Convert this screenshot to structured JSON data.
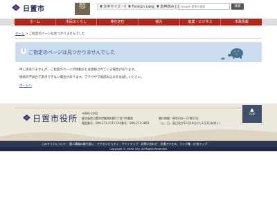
{
  "header": {
    "logo_text": "日置市",
    "helper": {
      "line1": "総合",
      "line2": "TOP"
    },
    "links": [
      {
        "label": "▼ 文字サイズ・色合い"
      },
      {
        "label": "▼ Foreign Language"
      },
      {
        "label": "▼ 音声読み上げ"
      }
    ],
    "search_placeholder": "Google 提供の検索",
    "search_button": "検索"
  },
  "nav": {
    "items": [
      {
        "label": "ホーム"
      },
      {
        "label": "市民のくらし"
      },
      {
        "label": "移住定住"
      },
      {
        "label": "観光"
      },
      {
        "label": "産業・ビジネス"
      },
      {
        "label": "市政情報"
      }
    ]
  },
  "breadcrumb": {
    "home": "ホーム",
    "separator": " > ",
    "current": "ご指定のページは見つかりませんでした"
  },
  "notice": {
    "icon": "i",
    "title": "ご指定のページは見つかりませんでした"
  },
  "body": {
    "line1": "申し訳ありませんが、ご指定のページが移動または削除されている場合があります。",
    "line2": "接続の不具合で表示できない場合があります。ブラウザで再読み込みをお試しください。",
    "home_link": "ホームへ"
  },
  "footer": {
    "logo_text": "日置市役所",
    "postal": "〒899-2592",
    "address": "鹿児島県日置市伊集院町郡1丁目100番地",
    "phone": "電話番号：099-273-2111 FAX番号：099-273-3863",
    "hours": "開庁時間：8時30分～17時15分",
    "hours_note": "（土、日、祝日及び12月29日から1月3日を除く）",
    "top_label": "TOP",
    "links": [
      {
        "label": "このサイトについて"
      },
      {
        "label": "個人情報の取り扱い"
      },
      {
        "label": "アクセシビリティ"
      },
      {
        "label": "サイトマップ"
      },
      {
        "label": "お問い合わせ"
      },
      {
        "label": "交通アクセス"
      },
      {
        "label": "リンク集"
      },
      {
        "label": "庁舎マップ"
      }
    ],
    "copyright": "Copyright © HIOKI City. All Rights Reserved."
  },
  "colors": {
    "nav_red": "#b42418",
    "notice_blue": "#cdddf0",
    "footer_navy": "#2e3a55"
  }
}
